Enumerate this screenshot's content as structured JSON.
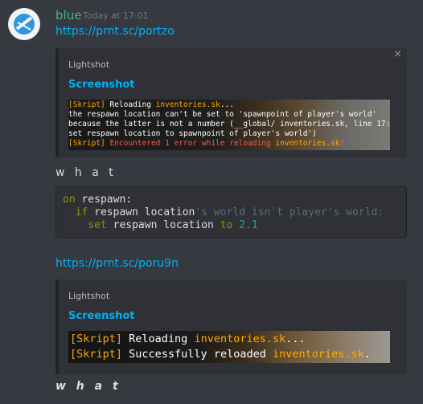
{
  "message": {
    "author": "blue",
    "timestamp": "Today at 17:01",
    "avatar_color": "#2f95dc",
    "username_color": "#43b581"
  },
  "link1": "https://prnt.sc/portzo",
  "embed1": {
    "provider": "Lightshot",
    "title": "Screenshot",
    "close_icon": "×",
    "lines": [
      {
        "parts": [
          {
            "t": "[Skript] ",
            "c": "gold"
          },
          {
            "t": "Reloading ",
            "c": "white"
          },
          {
            "t": "inventories.sk",
            "c": "gold"
          },
          {
            "t": "...",
            "c": "white"
          }
        ]
      },
      {
        "parts": [
          {
            "t": "the respawn location  can't be set to 'spawnpoint of player's world'",
            "c": "white"
          }
        ]
      },
      {
        "parts": [
          {
            "t": "because the latter is not a number (__global/ inventories.sk, line 17:",
            "c": "white"
          }
        ]
      },
      {
        "parts": [
          {
            "t": "set respawn location to spawnpoint of player's world')",
            "c": "white"
          }
        ]
      },
      {
        "parts": [
          {
            "t": "[Skript] ",
            "c": "gold"
          },
          {
            "t": "Encountered 1 error while reloading ",
            "c": "red"
          },
          {
            "t": "inventories.sk",
            "c": "gold"
          },
          {
            "t": "!",
            "c": "red"
          }
        ]
      }
    ]
  },
  "what1": "w h a t",
  "code": {
    "lines": [
      [
        {
          "t": "on",
          "c": "kw"
        },
        {
          "t": " respawn:",
          "c": "n"
        }
      ],
      [
        {
          "t": "  if",
          "c": "kw"
        },
        {
          "t": " respawn location",
          "c": "n"
        },
        {
          "t": "'s world isn't player's world:",
          "c": "dim"
        }
      ],
      [
        {
          "t": "    set",
          "c": "kw"
        },
        {
          "t": " respawn location ",
          "c": "n"
        },
        {
          "t": "to",
          "c": "kw"
        },
        {
          "t": " ",
          "c": "n"
        },
        {
          "t": "2.1",
          "c": "num"
        }
      ]
    ]
  },
  "link2": "https://prnt.sc/poru9n",
  "embed2": {
    "provider": "Lightshot",
    "title": "Screenshot",
    "lines": [
      {
        "parts": [
          {
            "t": "[Skript] ",
            "c": "gold"
          },
          {
            "t": "Reloading ",
            "c": "white"
          },
          {
            "t": "inventories.sk",
            "c": "gold"
          },
          {
            "t": "...",
            "c": "white"
          }
        ]
      },
      {
        "parts": [
          {
            "t": "[Skript] ",
            "c": "gold"
          },
          {
            "t": "Successfully reloaded ",
            "c": "white"
          },
          {
            "t": "inventories.sk",
            "c": "gold"
          },
          {
            "t": ".",
            "c": "white"
          }
        ]
      }
    ]
  },
  "what2": "w h a t"
}
